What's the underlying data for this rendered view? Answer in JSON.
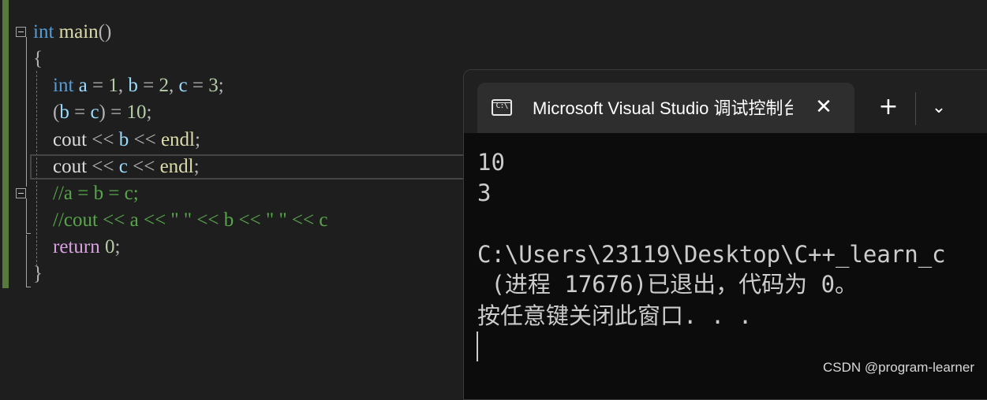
{
  "editor": {
    "lines": [
      [
        {
          "t": "int",
          "c": "kw"
        },
        {
          "t": " ",
          "c": ""
        },
        {
          "t": "main",
          "c": "fn"
        },
        {
          "t": "()",
          "c": "op"
        }
      ],
      [
        {
          "t": "{",
          "c": "op"
        }
      ],
      [
        {
          "t": "    ",
          "c": ""
        },
        {
          "t": "int",
          "c": "kw"
        },
        {
          "t": " ",
          "c": ""
        },
        {
          "t": "a",
          "c": "var"
        },
        {
          "t": " = ",
          "c": "op"
        },
        {
          "t": "1",
          "c": "num"
        },
        {
          "t": ", ",
          "c": "op"
        },
        {
          "t": "b",
          "c": "var"
        },
        {
          "t": " = ",
          "c": "op"
        },
        {
          "t": "2",
          "c": "num"
        },
        {
          "t": ", ",
          "c": "op"
        },
        {
          "t": "c",
          "c": "var"
        },
        {
          "t": " = ",
          "c": "op"
        },
        {
          "t": "3",
          "c": "num"
        },
        {
          "t": ";",
          "c": "op"
        }
      ],
      [
        {
          "t": "    ",
          "c": ""
        },
        {
          "t": "(",
          "c": "op"
        },
        {
          "t": "b",
          "c": "var"
        },
        {
          "t": " = ",
          "c": "op"
        },
        {
          "t": "c",
          "c": "var"
        },
        {
          "t": ") = ",
          "c": "op"
        },
        {
          "t": "10",
          "c": "num"
        },
        {
          "t": ";",
          "c": "op"
        }
      ],
      [
        {
          "t": "    ",
          "c": ""
        },
        {
          "t": "cout",
          "c": ""
        },
        {
          "t": " << ",
          "c": "op"
        },
        {
          "t": "b",
          "c": "var"
        },
        {
          "t": " << ",
          "c": "op"
        },
        {
          "t": "endl",
          "c": "fn"
        },
        {
          "t": ";",
          "c": "op"
        }
      ],
      [
        {
          "t": "    ",
          "c": ""
        },
        {
          "t": "cout",
          "c": ""
        },
        {
          "t": " << ",
          "c": "op"
        },
        {
          "t": "c",
          "c": "var"
        },
        {
          "t": " << ",
          "c": "op"
        },
        {
          "t": "endl",
          "c": "fn"
        },
        {
          "t": ";",
          "c": "op"
        }
      ],
      [
        {
          "t": "    ",
          "c": ""
        },
        {
          "t": "//a = b = c;",
          "c": "com"
        }
      ],
      [
        {
          "t": "    ",
          "c": ""
        },
        {
          "t": "//cout << a << \" \" << b << \" \" << c",
          "c": "com"
        }
      ],
      [
        {
          "t": "    ",
          "c": ""
        },
        {
          "t": "return",
          "c": "kw2"
        },
        {
          "t": " ",
          "c": ""
        },
        {
          "t": "0",
          "c": "num"
        },
        {
          "t": ";",
          "c": "op"
        }
      ],
      [
        {
          "t": "}",
          "c": "op"
        }
      ]
    ]
  },
  "terminal": {
    "tab_title": "Microsoft Visual Studio 调试控制台",
    "tab_icon_text": "C:\\",
    "close_glyph": "✕",
    "new_tab_glyph": "+",
    "dropdown_glyph": "⌄",
    "output_lines": [
      "10",
      "3",
      "",
      "C:\\Users\\23119\\Desktop\\C++_learn_c",
      " (进程 17676)已退出，代码为 0。",
      "按任意键关闭此窗口. . ."
    ]
  },
  "watermark": "CSDN @program-learner"
}
